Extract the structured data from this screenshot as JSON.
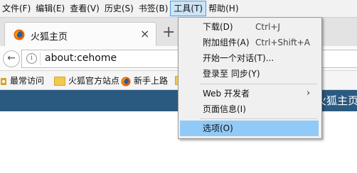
{
  "menubar": {
    "items": [
      "文件(F)",
      "编辑(E)",
      "查看(V)",
      "历史(S)",
      "书签(B)",
      "工具(T)",
      "帮助(H)"
    ],
    "active_index": 5
  },
  "tab": {
    "title": "火狐主页",
    "close": "×",
    "newtab": "+"
  },
  "nav": {
    "back": "←",
    "info": "i",
    "url": "about:cehome"
  },
  "bookmarks": {
    "items": [
      "最常访问",
      "火狐官方站点",
      "新手上路"
    ]
  },
  "page": {
    "banner_title": "火狐主页"
  },
  "tools_menu": {
    "items": [
      {
        "label": "下载(D)",
        "shortcut": "Ctrl+J"
      },
      {
        "label": "附加组件(A)",
        "shortcut": "Ctrl+Shift+A"
      },
      {
        "label": "开始一个对话(T)..."
      },
      {
        "label": "登录至 同步(Y)"
      },
      {
        "label": "Web 开发者",
        "submenu": "›"
      },
      {
        "label": "页面信息(I)"
      },
      {
        "label": "选项(O)"
      }
    ]
  },
  "colors": {
    "menu_highlight": "#91c9f7",
    "banner": "#2b5a80",
    "firefox_orange": "#e66000"
  }
}
